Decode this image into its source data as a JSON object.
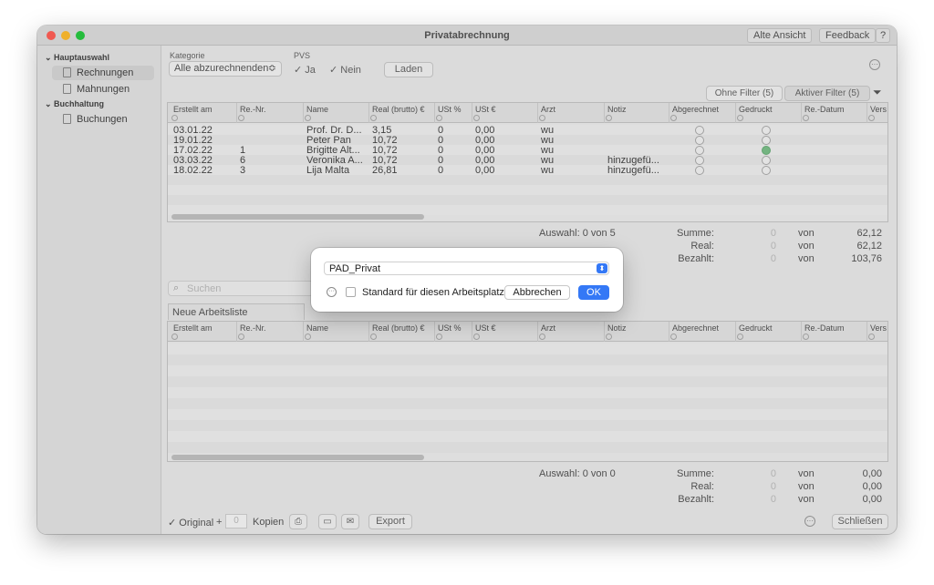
{
  "window": {
    "title": "Privatabrechnung",
    "btn_old_view": "Alte Ansicht",
    "btn_feedback": "Feedback",
    "btn_help": "?"
  },
  "sidebar": {
    "group_main": "Hauptauswahl",
    "item_invoices": "Rechnungen",
    "item_reminders": "Mahnungen",
    "group_accounting": "Buchhaltung",
    "item_bookings": "Buchungen"
  },
  "filters": {
    "category_label": "Kategorie",
    "category_value": "Alle abzurechnenden",
    "pvs_label": "PVS",
    "pvs_yes": "Ja",
    "pvs_no": "Nein",
    "load_button": "Laden",
    "without_filter": "Ohne Filter (5)",
    "active_filter": "Aktiver Filter (5)"
  },
  "columns": [
    "Erstellt am",
    "Re.-Nr.",
    "Name",
    "Real (brutto) €",
    "USt %",
    "USt €",
    "Arzt",
    "Notiz",
    "Abgerechnet",
    "Gedruckt",
    "Re.-Datum",
    "Vers"
  ],
  "rows": [
    {
      "date": "03.01.22",
      "nr": "",
      "name": "Prof. Dr. D...",
      "real": "3,15",
      "ust_p": "0",
      "ust": "0,00",
      "arzt": "wu",
      "notiz": "",
      "printed": false
    },
    {
      "date": "19.01.22",
      "nr": "",
      "name": "Peter Pan",
      "real": "10,72",
      "ust_p": "0",
      "ust": "0,00",
      "arzt": "wu",
      "notiz": "",
      "printed": false
    },
    {
      "date": "17.02.22",
      "nr": "1",
      "name": "Brigitte Alt...",
      "real": "10,72",
      "ust_p": "0",
      "ust": "0,00",
      "arzt": "wu",
      "notiz": "",
      "printed": true
    },
    {
      "date": "03.03.22",
      "nr": "6",
      "name": "Veronika A...",
      "real": "10,72",
      "ust_p": "0",
      "ust": "0,00",
      "arzt": "wu",
      "notiz": "hinzugefü...",
      "printed": false
    },
    {
      "date": "18.02.22",
      "nr": "3",
      "name": "Lija Malta",
      "real": "26,81",
      "ust_p": "0",
      "ust": "0,00",
      "arzt": "wu",
      "notiz": "hinzugefü...",
      "printed": false
    }
  ],
  "summary_top": {
    "selection": "Auswahl: 0 von 5",
    "sum_label": "Summe:",
    "sum_sel": "0",
    "sum_of": "von",
    "sum_total": "62,12",
    "real_label": "Real:",
    "real_sel": "0",
    "real_of": "von",
    "real_total": "62,12",
    "paid_label": "Bezahlt:",
    "paid_sel": "0",
    "paid_of": "von",
    "paid_total": "103,76"
  },
  "search_placeholder": "Suchen",
  "worklist_tab": "Neue Arbeitsliste",
  "summary_bottom": {
    "selection": "Auswahl: 0 von 0",
    "sum_label": "Summe:",
    "sum_sel": "0",
    "sum_of": "von",
    "sum_total": "0,00",
    "real_label": "Real:",
    "real_sel": "0",
    "real_of": "von",
    "real_total": "0,00",
    "paid_label": "Bezahlt:",
    "paid_sel": "0",
    "paid_of": "von",
    "paid_total": "0,00"
  },
  "footer": {
    "original": "Original",
    "plus": "+",
    "copies_value": "0",
    "copies_label": "Kopien",
    "export": "Export",
    "close": "Schließen"
  },
  "dialog": {
    "select_value": "PAD_Privat",
    "checkbox_label": "Standard für diesen Arbeitsplatz",
    "cancel": "Abbrechen",
    "ok": "OK"
  },
  "colors": {
    "accent": "#3478f6",
    "check_green": "#7cc08a",
    "close": "#ff5f57",
    "minimize": "#febc2e",
    "zoom": "#28c840"
  }
}
